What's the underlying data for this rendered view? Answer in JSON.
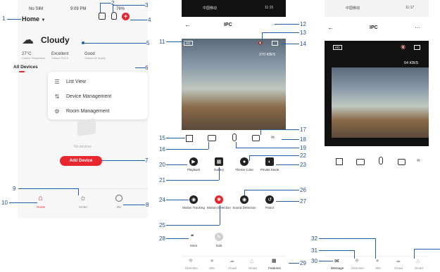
{
  "phone1": {
    "status": {
      "carrier": "No SIM",
      "time": "9:09 PM",
      "battery": "76%"
    },
    "home_title": "Home",
    "weather": {
      "condition": "Cloudy",
      "temp": "27°C",
      "temp_label": "Outdoor Temperature",
      "aq": "Excellent",
      "aq_label": "Outdoor PM2.5",
      "aq2": "Good",
      "aq2_label": "Outdoor Air Quality"
    },
    "tab_all": "All Devices",
    "menu": [
      "List View",
      "Device Management",
      "Room Management"
    ],
    "no_devices": "No devices",
    "add_device": "Add Device",
    "tabbar": [
      "Home",
      "Smart",
      "Me"
    ]
  },
  "phone2": {
    "status": {
      "left": "中国移动",
      "right": "11:15"
    },
    "title": "IPC",
    "hd": "HD",
    "speed": "370 KB/S",
    "features": {
      "row1": [
        "Playback",
        "Gallery",
        "Theme Color",
        "Private Mode"
      ],
      "row2": [
        "Motion Tracking",
        "Motion Detection",
        "Sound Detection",
        "Patrol"
      ],
      "row3": [
        "Siren",
        "Edit"
      ]
    },
    "tabbar": [
      "Direction",
      "Site",
      "Cloud",
      "Smart",
      "Features"
    ]
  },
  "phone3": {
    "status": {
      "left": "中国移动",
      "right": "11:17"
    },
    "title": "IPC",
    "more": "···",
    "hd": "HD",
    "speed": "54 KB/S",
    "tabbar": [
      "Message",
      "Direction",
      "Site",
      "Cloud",
      "Smart"
    ]
  },
  "callouts": [
    "1",
    "2",
    "3",
    "4",
    "5",
    "6",
    "7",
    "8",
    "9",
    "10",
    "11",
    "12",
    "13",
    "14",
    "15",
    "16",
    "17",
    "18",
    "19",
    "20",
    "21",
    "22",
    "23",
    "24",
    "25",
    "26",
    "27",
    "28",
    "29",
    "30",
    "31",
    "32"
  ]
}
